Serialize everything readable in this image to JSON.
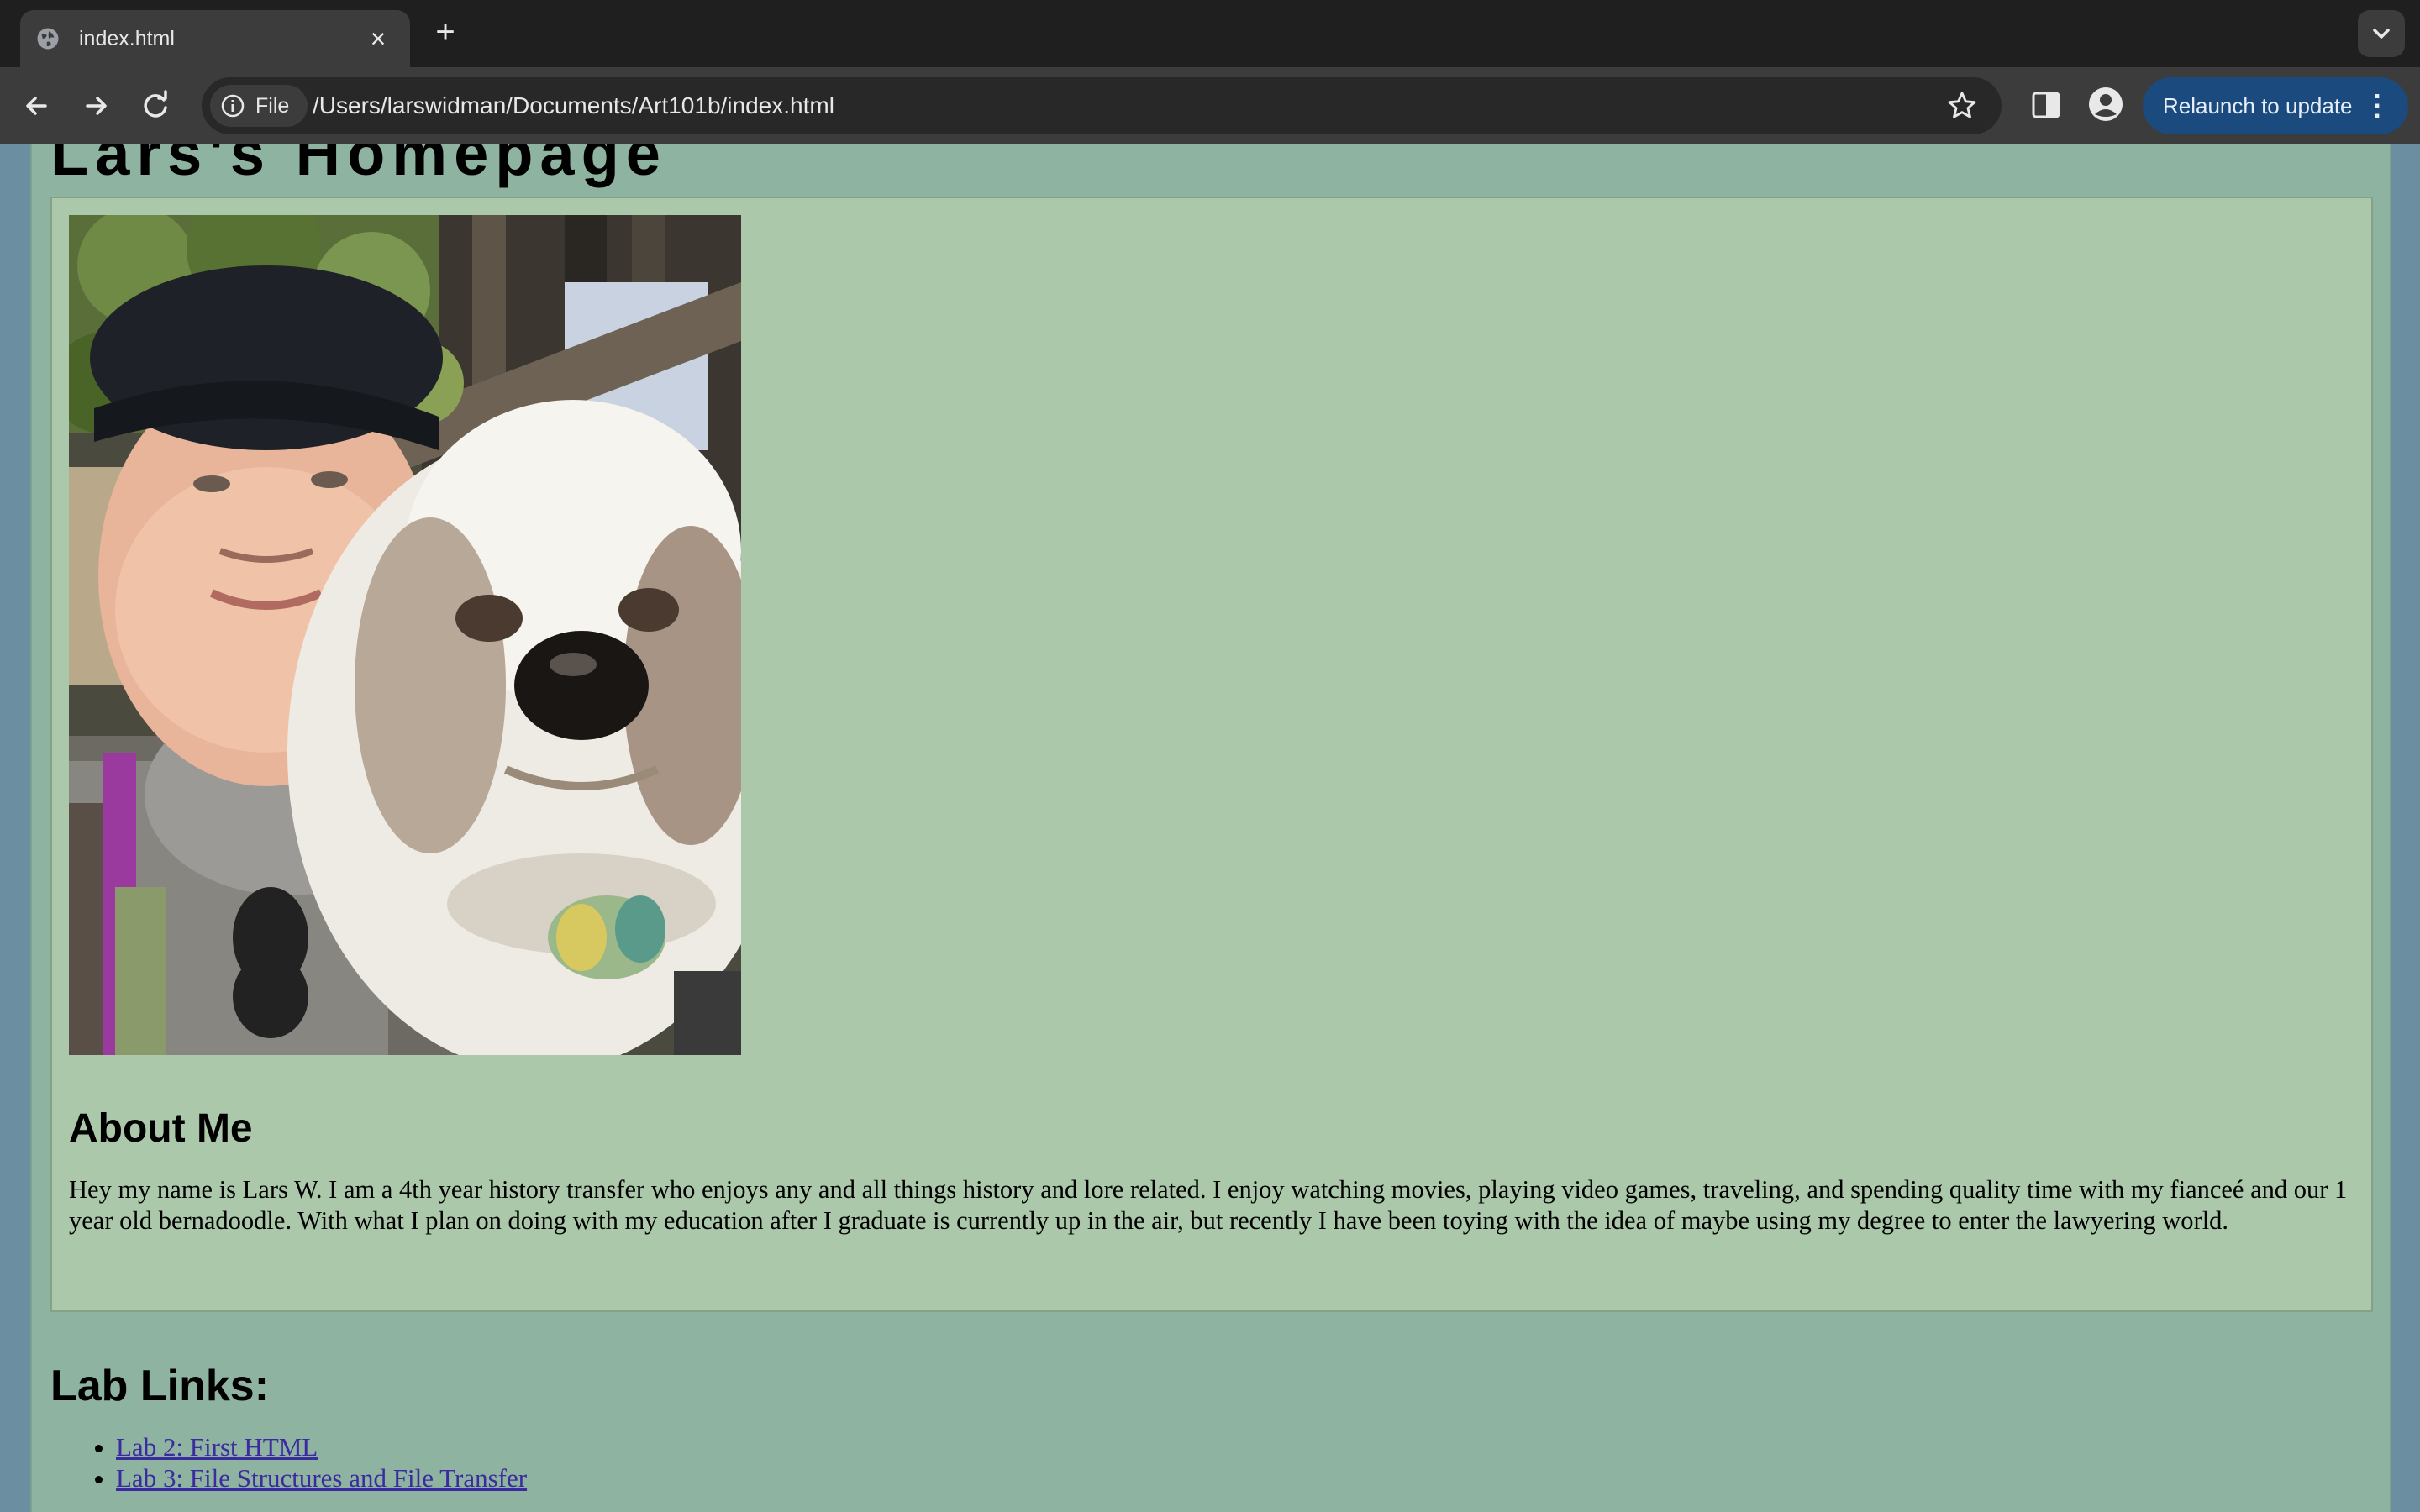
{
  "browser": {
    "tab_title": "index.html",
    "tab_close": "×",
    "new_tab": "+",
    "site_chip_label": "File",
    "url": "/Users/larswidman/Documents/Art101b/index.html",
    "relaunch_label": "Relaunch to update",
    "relaunch_menu": "⋮",
    "icons": [
      "globe-icon",
      "back-icon",
      "forward-icon",
      "reload-icon",
      "info-icon",
      "star-icon",
      "side-panel-icon",
      "profile-icon",
      "tab-search-icon"
    ]
  },
  "page": {
    "title": "Lars's Homepage",
    "about_heading": "About Me",
    "about_text": "Hey my name is Lars W. I am a 4th year history transfer who enjoys any and all things history and lore related. I enjoy watching movies, playing video games, traveling, and spending quality time with my fianceé and our 1 year old bernadoodle. With what I plan on doing with my education after I graduate is currently up in the air, but recently I have been toying with the idea of maybe using my degree to enter the lawyering world.",
    "lab_heading": "Lab Links:",
    "lab_links": [
      {
        "label": "Lab 2: First HTML"
      },
      {
        "label": "Lab 3: File Structures and File Transfer"
      }
    ]
  },
  "colors": {
    "page_background": "#8eb3a0",
    "card_background": "#abc8aa",
    "outer_background": "#6b8fa0",
    "link_color": "#3b2aa0",
    "relaunch_button": "#1b4a7e"
  }
}
